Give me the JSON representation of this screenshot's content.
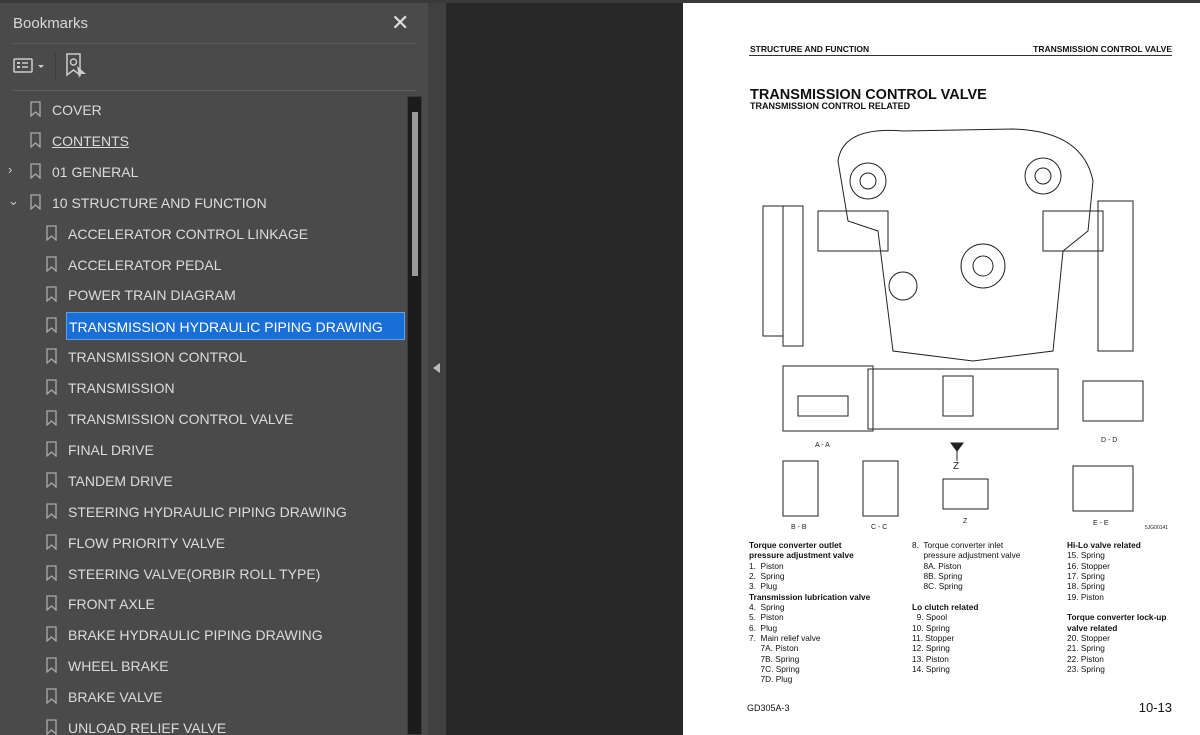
{
  "panel": {
    "title": "Bookmarks",
    "close": "✕"
  },
  "bookmarks": [
    {
      "label": "COVER",
      "level": 0
    },
    {
      "label": "CONTENTS",
      "level": 0,
      "underline": true
    },
    {
      "label": "01 GENERAL",
      "level": 0,
      "expander": "›"
    },
    {
      "label": "10 STRUCTURE AND FUNCTION",
      "level": 0,
      "expander": "⌄"
    },
    {
      "label": "ACCELERATOR CONTROL LINKAGE",
      "level": 1
    },
    {
      "label": "ACCELERATOR PEDAL",
      "level": 1
    },
    {
      "label": "POWER TRAIN DIAGRAM",
      "level": 1
    },
    {
      "label": "TRANSMISSION HYDRAULIC PIPING DRAWING",
      "level": 1,
      "selected": true
    },
    {
      "label": "TRANSMISSION CONTROL",
      "level": 1
    },
    {
      "label": "TRANSMISSION",
      "level": 1
    },
    {
      "label": "TRANSMISSION CONTROL VALVE",
      "level": 1
    },
    {
      "label": "FINAL DRIVE",
      "level": 1
    },
    {
      "label": "TANDEM DRIVE",
      "level": 1
    },
    {
      "label": "STEERING HYDRAULIC PIPING DRAWING",
      "level": 1
    },
    {
      "label": "FLOW PRIORITY VALVE",
      "level": 1
    },
    {
      "label": "STEERING VALVE(ORBIR ROLL TYPE)",
      "level": 1
    },
    {
      "label": "FRONT AXLE",
      "level": 1
    },
    {
      "label": "BRAKE HYDRAULIC PIPING DRAWING",
      "level": 1
    },
    {
      "label": "WHEEL BRAKE",
      "level": 1
    },
    {
      "label": "BRAKE VALVE",
      "level": 1
    },
    {
      "label": "UNLOAD RELIEF VALVE",
      "level": 1
    }
  ],
  "page": {
    "header_left": "STRUCTURE AND FUNCTION",
    "header_right": "TRANSMISSION CONTROL VALVE",
    "title": "TRANSMISSION CONTROL VALVE",
    "subtitle": "TRANSMISSION CONTROL RELATED",
    "diagram_labels": [
      "A - A",
      "B - B",
      "C - C",
      "D - D",
      "E - E",
      "Z",
      "Z",
      "5JG00141"
    ],
    "col1": [
      "Torque converter outlet",
      "pressure adjustment valve",
      "1.  Piston",
      "2.  Spring",
      "3.  Plug",
      "Transmission lubrication valve",
      "4.  Spring",
      "5.  Piston",
      "6.  Plug",
      "7.  Main relief valve",
      "     7A. Piston",
      "     7B. Spring",
      "     7C. Spring",
      "     7D. Plug"
    ],
    "col2": [
      "8.  Torque converter inlet",
      "     pressure adjustment valve",
      "     8A. Piston",
      "     8B. Spring",
      "     8C. Spring",
      "",
      "Lo clutch related",
      "  9. Spool",
      "10. Spring",
      "11. Stopper",
      "12. Spring",
      "13. Piston",
      "14. Spring"
    ],
    "col3": [
      "Hi-Lo valve related",
      "15. Spring",
      "16. Stopper",
      "17. Spring",
      "18. Spring",
      "19. Piston",
      "",
      "Torque converter lock-up",
      "valve related",
      "20. Stopper",
      "21. Spring",
      "22. Piston",
      "23. Spring"
    ],
    "footer_left": "GD305A-3",
    "page_number": "10-13"
  },
  "colors": {
    "panel": "#4a4a4a",
    "selection": "#1a6fd6",
    "viewer": "#282828"
  }
}
